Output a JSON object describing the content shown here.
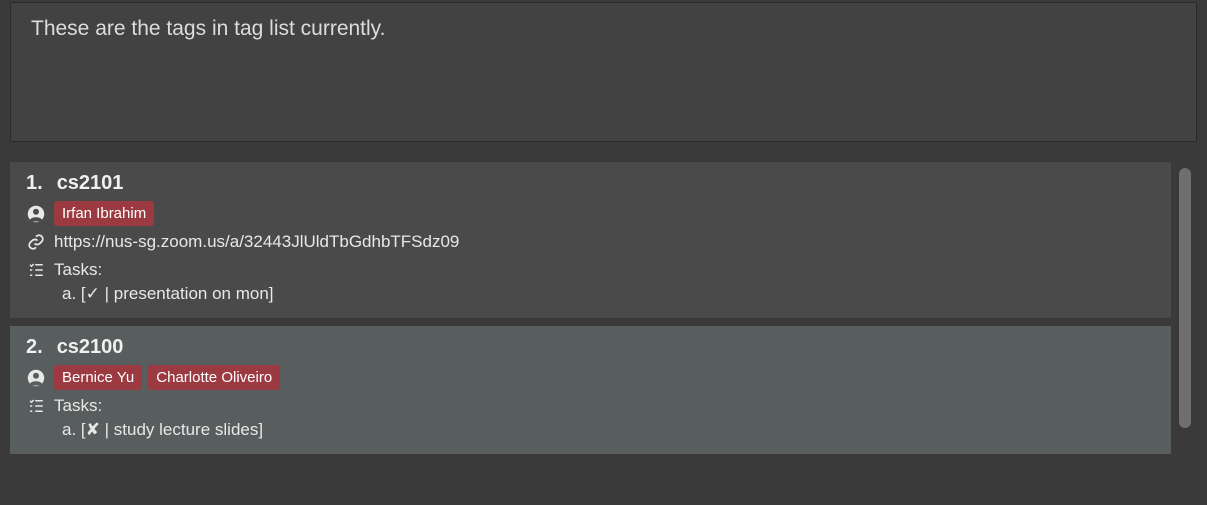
{
  "message": "These are the tags in tag list currently.",
  "tasks_label": "Tasks:",
  "items": [
    {
      "index": "1.",
      "title": "cs2101",
      "people": [
        "Irfan Ibrahim"
      ],
      "link": "https://nus-sg.zoom.us/a/32443JlUldTbGdhbTFSdz09",
      "tasks": [
        {
          "letter": "a.",
          "done_glyph": "✓",
          "text": "presentation on mon"
        }
      ]
    },
    {
      "index": "2.",
      "title": "cs2100",
      "people": [
        "Bernice Yu",
        "Charlotte Oliveiro"
      ],
      "link": null,
      "tasks": [
        {
          "letter": "a.",
          "done_glyph": "✘",
          "text": "study lecture slides"
        }
      ]
    }
  ]
}
